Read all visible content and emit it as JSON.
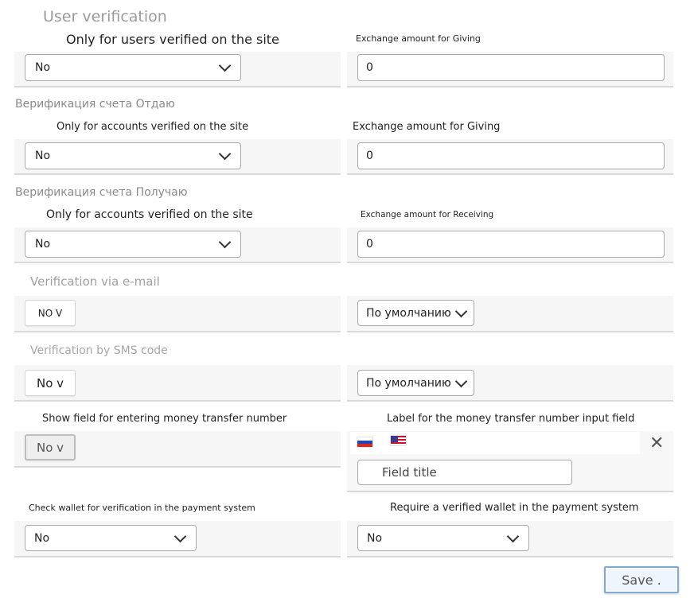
{
  "sections": {
    "user_verification": {
      "title": "User verification",
      "left_label": "Only for users verified on the site",
      "left_value": "No",
      "right_label": "Exchange amount for Giving",
      "right_value": "0"
    },
    "account_giving": {
      "title": "Верификация счета Отдаю",
      "left_label": "Only for accounts verified on the site",
      "left_value": "No",
      "right_label": "Exchange amount for Giving",
      "right_value": "0"
    },
    "account_receiving": {
      "title": "Верификация счета Получаю",
      "left_label": "Only for accounts verified on the site",
      "left_value": "No",
      "right_label": "Exchange amount for Receiving",
      "right_value": "0"
    },
    "email": {
      "title": "Verification via e-mail",
      "left_value": "NO V",
      "right_value": "По умолчанию"
    },
    "sms": {
      "title": "Verification by SMS code",
      "left_value": "No v",
      "right_value": "По умолчанию"
    },
    "transfer": {
      "left_label": "Show field for entering money transfer number",
      "left_value": "No v",
      "right_label": "Label for the money transfer number input field",
      "field_placeholder": "Field title",
      "flags": [
        "flag-ru-icon",
        "flag-us-icon"
      ]
    },
    "wallet": {
      "left_label": "Check wallet for verification in the payment system",
      "left_value": "No",
      "right_label": "Require a verified wallet in the payment system",
      "right_value": "No"
    }
  },
  "save_label": "Save ."
}
